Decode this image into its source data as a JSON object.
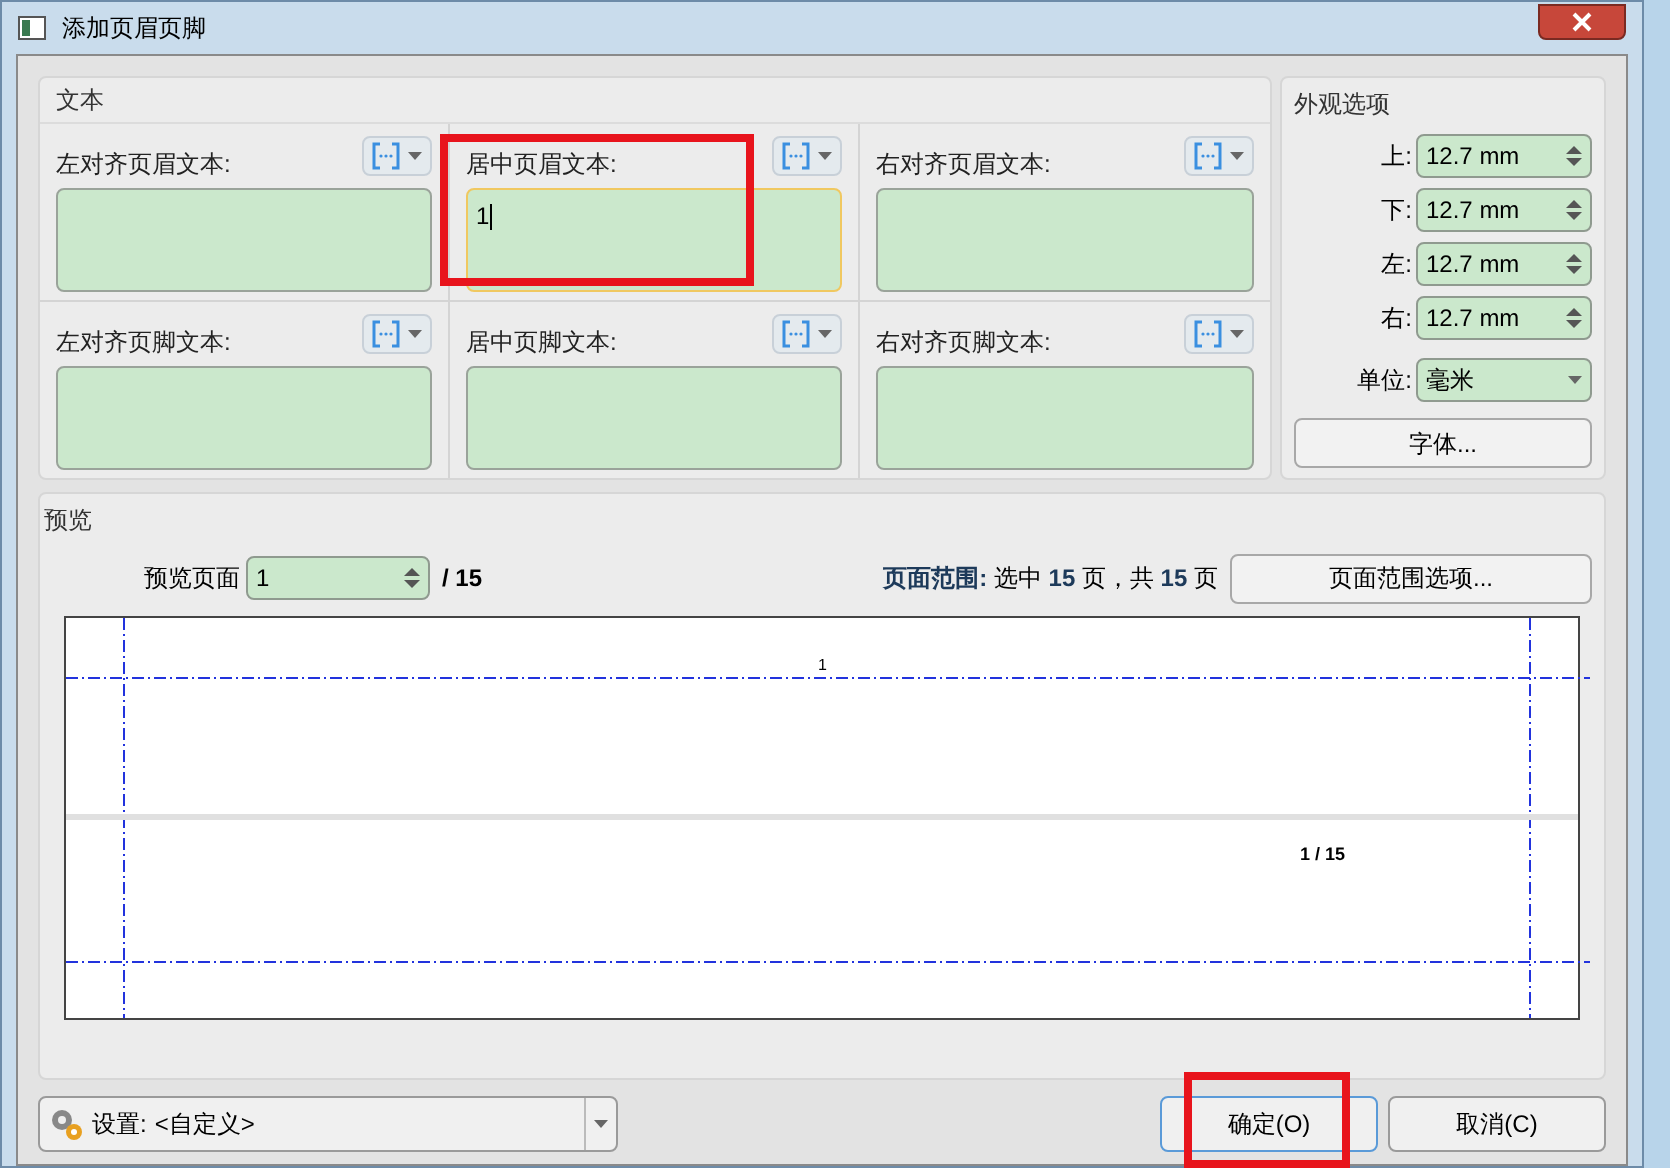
{
  "window": {
    "title": "添加页眉页脚"
  },
  "text_group": {
    "title": "文本",
    "fields": [
      {
        "label": "左对齐页眉文本:",
        "focused": false
      },
      {
        "label": "居中页眉文本:",
        "value": "1",
        "focused": true
      },
      {
        "label": "右对齐页眉文本:",
        "focused": false
      },
      {
        "label": "左对齐页脚文本:",
        "focused": false
      },
      {
        "label": "居中页脚文本:",
        "focused": false
      },
      {
        "label": "右对齐页脚文本:",
        "focused": false
      }
    ]
  },
  "appearance": {
    "title": "外观选项",
    "margins": [
      {
        "label": "上:",
        "value": "12.7 mm"
      },
      {
        "label": "下:",
        "value": "12.7 mm"
      },
      {
        "label": "左:",
        "value": "12.7 mm"
      },
      {
        "label": "右:",
        "value": "12.7 mm"
      }
    ],
    "unit": {
      "label": "单位:",
      "value": "毫米"
    },
    "font_button": "字体..."
  },
  "preview": {
    "title": "预览",
    "page_label": "预览页面",
    "page_value": "1",
    "page_total": "/ 15",
    "range_text": "**页面范围:** 选中 **15** 页，共 **15** 页",
    "range_button": "页面范围选项...",
    "header_text": "1",
    "footer_text": "1 / 15"
  },
  "footer": {
    "settings_label": "设置:",
    "settings_value": "<自定义>",
    "ok": "确定(O)",
    "cancel": "取消(C)"
  }
}
